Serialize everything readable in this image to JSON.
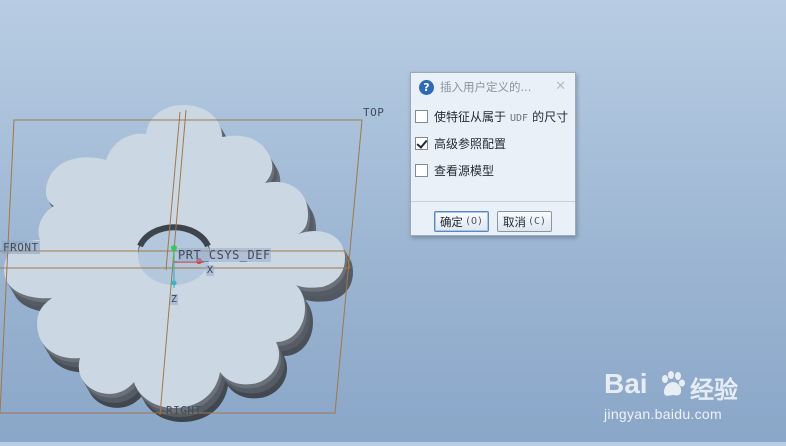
{
  "viewport": {
    "planes": {
      "top": "TOP",
      "front": "FRONT",
      "right": "RIGHT"
    },
    "csys": "PRT_CSYS_DEF",
    "axes": {
      "x": "X",
      "z": "Z"
    }
  },
  "dialog": {
    "title": "插入用户定义的...",
    "options": [
      {
        "label_pre": "使特征从属于",
        "label_mono": "UDF",
        "label_post": "的尺寸",
        "checked": false
      },
      {
        "label": "高级参照配置",
        "checked": true
      },
      {
        "label": "查看源模型",
        "checked": false
      }
    ],
    "buttons": {
      "ok_label": "确定",
      "ok_key": "(O)",
      "cancel_label": "取消",
      "cancel_key": "(C)"
    }
  },
  "watermark": {
    "brand": "Bai",
    "brand_cn": "经验",
    "url": "jingyan.baidu.com"
  }
}
